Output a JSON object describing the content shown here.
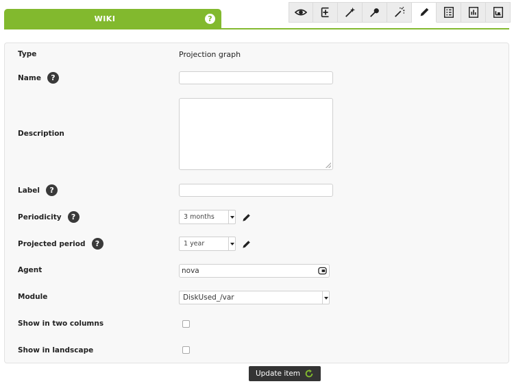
{
  "header": {
    "wiki_label": "WIKI",
    "help_glyph": "?",
    "accent_color": "#82b92e",
    "toolbar": [
      {
        "icon": "eye-icon",
        "active": false
      },
      {
        "icon": "add-element-icon",
        "active": false
      },
      {
        "icon": "magic-wand-icon",
        "active": false
      },
      {
        "icon": "pin-icon",
        "active": false
      },
      {
        "icon": "sparkle-wand-icon",
        "active": false
      },
      {
        "icon": "pencil-icon",
        "active": true
      },
      {
        "icon": "list-icon",
        "active": false
      },
      {
        "icon": "bar-chart-icon",
        "active": false
      },
      {
        "icon": "dashboard-icon",
        "active": false
      }
    ]
  },
  "form": {
    "type_label": "Type",
    "type_value": "Projection graph",
    "name_label": "Name",
    "name_value": "",
    "description_label": "Description",
    "description_value": "",
    "label_label": "Label",
    "label_value": "",
    "periodicity_label": "Periodicity",
    "periodicity_value": "3 months",
    "projected_period_label": "Projected period",
    "projected_period_value": "1 year",
    "agent_label": "Agent",
    "agent_value": "nova",
    "module_label": "Module",
    "module_value": "DiskUsed_/var",
    "two_columns_label": "Show in two columns",
    "two_columns_checked": false,
    "landscape_label": "Show in landscape",
    "landscape_checked": false,
    "help_glyph": "?"
  },
  "footer": {
    "update_label": "Update item"
  }
}
